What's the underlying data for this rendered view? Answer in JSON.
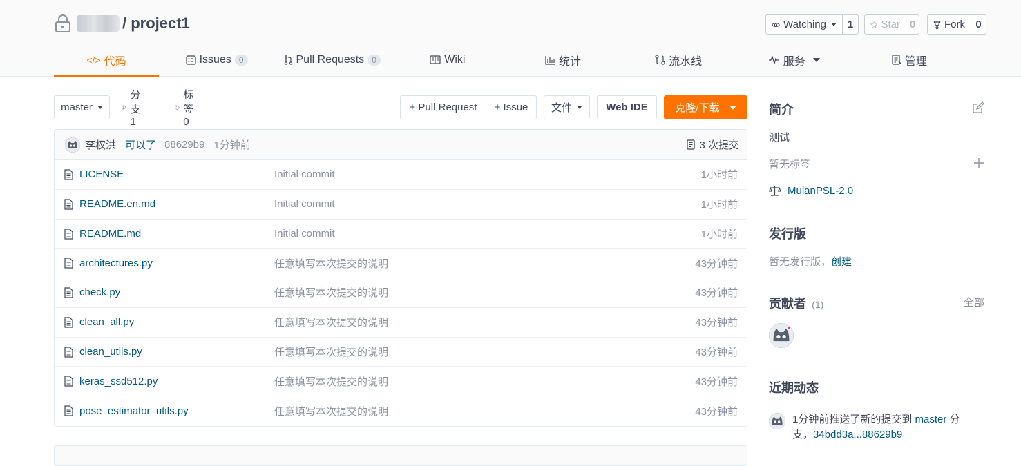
{
  "repo": {
    "name": "/ project1"
  },
  "social": {
    "watch": {
      "label": "Watching",
      "count": "1"
    },
    "star": {
      "label": "Star",
      "count": "0"
    },
    "fork": {
      "label": "Fork",
      "count": "0"
    }
  },
  "tabs": [
    {
      "label": "代码",
      "icon": "code-icon",
      "active": true
    },
    {
      "label": "Issues",
      "badge": "0",
      "icon": "issues-icon"
    },
    {
      "label": "Pull Requests",
      "badge": "0",
      "icon": "pull-request-icon"
    },
    {
      "label": "Wiki",
      "icon": "wiki-icon"
    },
    {
      "label": "统计",
      "icon": "stats-icon"
    },
    {
      "label": "流水线",
      "icon": "pipeline-icon"
    },
    {
      "label": "服务",
      "icon": "service-icon",
      "dropdown": true
    },
    {
      "label": "管理",
      "icon": "manage-icon"
    }
  ],
  "toolbar": {
    "branch": "master",
    "branches_label": "分支 1",
    "tags_label": "标签 0",
    "pull_request": "+ Pull Request",
    "issue": "+ Issue",
    "file": "文件",
    "web_ide": "Web IDE",
    "clone": "克隆/下载"
  },
  "commit": {
    "author": "李权洪",
    "message": "可以了",
    "sha": "88629b9",
    "time": "1分钟前",
    "count_label": "3 次提交"
  },
  "files": [
    {
      "name": "LICENSE",
      "message": "Initial commit",
      "time": "1小时前"
    },
    {
      "name": "README.en.md",
      "message": "Initial commit",
      "time": "1小时前"
    },
    {
      "name": "README.md",
      "message": "Initial commit",
      "time": "1小时前"
    },
    {
      "name": "architectures.py",
      "message": "任意填写本次提交的说明",
      "time": "43分钟前"
    },
    {
      "name": "check.py",
      "message": "任意填写本次提交的说明",
      "time": "43分钟前"
    },
    {
      "name": "clean_all.py",
      "message": "任意填写本次提交的说明",
      "time": "43分钟前"
    },
    {
      "name": "clean_utils.py",
      "message": "任意填写本次提交的说明",
      "time": "43分钟前"
    },
    {
      "name": "keras_ssd512.py",
      "message": "任意填写本次提交的说明",
      "time": "43分钟前"
    },
    {
      "name": "pose_estimator_utils.py",
      "message": "任意填写本次提交的说明",
      "time": "43分钟前"
    }
  ],
  "sidebar": {
    "intro_title": "简介",
    "intro_text": "测试",
    "no_tags": "暂无标签",
    "license": "MulanPSL-2.0",
    "release_title": "发行版",
    "no_release": "暂无发行版，",
    "create": "创建",
    "contributors_title": "贡献者",
    "contributors_count": "(1)",
    "all": "全部",
    "activity_title": "近期动态",
    "activity_text": "1分钟前推送了新的提交到",
    "activity_branch": "master",
    "activity_suffix": "分",
    "activity_line2_prefix": "支，",
    "activity_range": "34bdd3a...88629b9"
  },
  "colors": {
    "accent": "#fe7300",
    "link": "#005980",
    "muted": "#8c92a4",
    "text": "#40485b"
  }
}
